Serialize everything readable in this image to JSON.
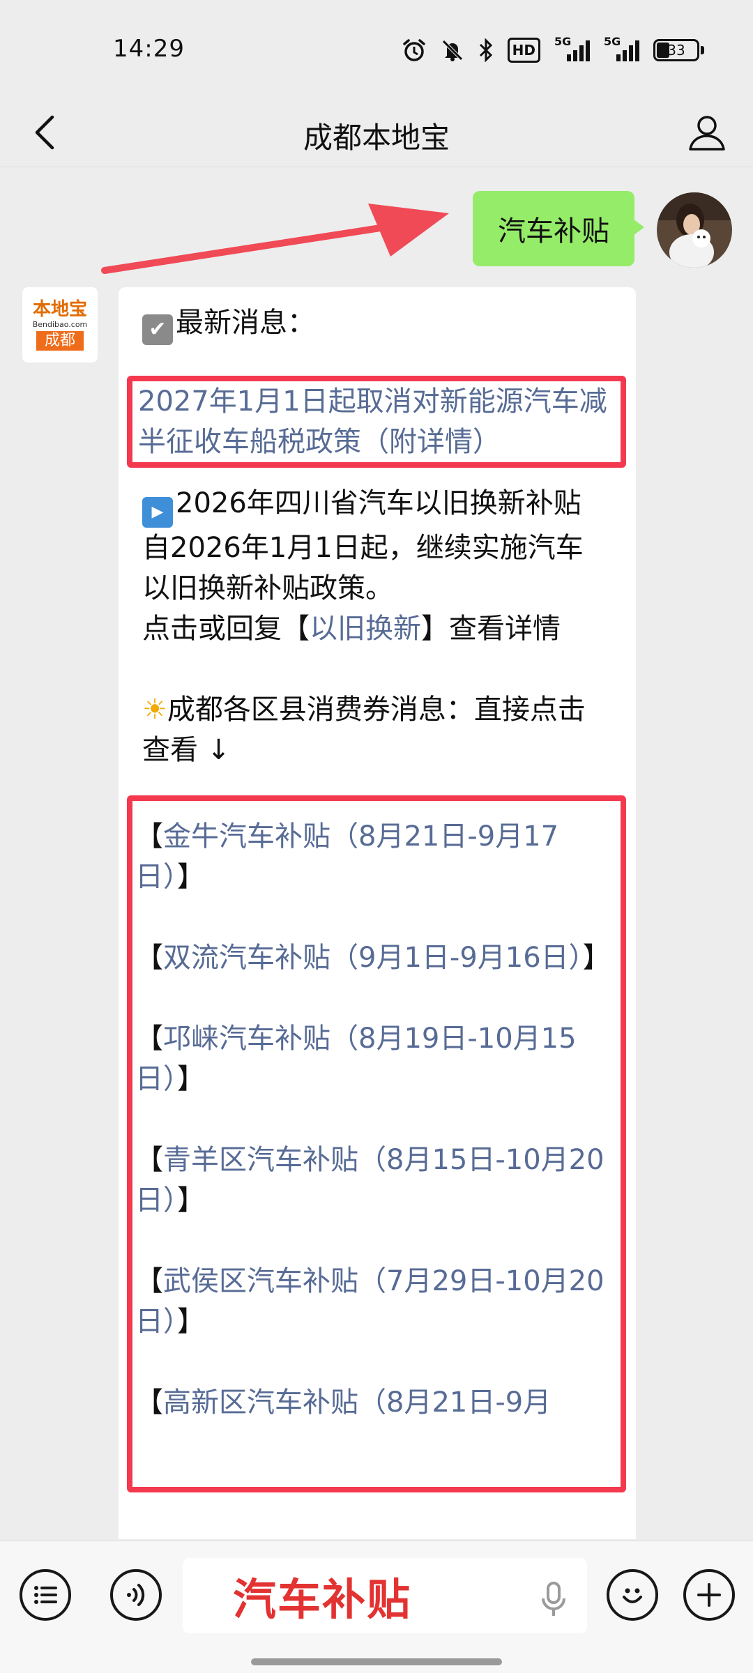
{
  "status_bar": {
    "time": "14:29",
    "hd_label": "HD",
    "sim1_label": "5G",
    "sim2_label": "5G",
    "battery_percent": "33",
    "battery_level": 0.33,
    "icons": [
      "alarm-icon",
      "mute-icon",
      "bluetooth-icon",
      "hd-voice-icon",
      "signal-icon",
      "signal-icon",
      "battery-icon"
    ]
  },
  "header": {
    "title": "成都本地宝",
    "back_icon": "chevron-left-icon",
    "profile_icon": "person-icon"
  },
  "chat": {
    "user_message": "汽车补贴",
    "official_account": {
      "logo_brand": "本地宝",
      "logo_domain": "Bendibao.com",
      "logo_city": "成都"
    },
    "reply": {
      "latest_heading": "最新消息：",
      "tax_policy_link": "2027年1月1日起取消对新能源汽车减半征收车船税政策（附详情）",
      "sichuan_title": "2026年四川省汽车以旧换新补贴",
      "sichuan_body": "自2026年1月1日起，继续实施汽车以旧换新补贴政策。",
      "reply_prefix": "点击或回复【",
      "reply_link": "以旧换新",
      "reply_suffix": "】查看详情",
      "vouchers_heading": "成都各区县消费券消息：直接点击查看 ↓",
      "district_items": [
        {
          "text": "金牛汽车补贴（8月21日-9月17日）"
        },
        {
          "text": "双流汽车补贴（9月1日-9月16日）"
        },
        {
          "text": "邛崃汽车补贴（8月19日-10月15日）"
        },
        {
          "text": "青羊区汽车补贴（8月15日-10月20日）"
        },
        {
          "text": "武侯区汽车补贴（7月29日-10月20日）"
        },
        {
          "text": "高新区汽车补贴（8月21日-9月"
        }
      ],
      "bracket_open": "【",
      "bracket_close": "】"
    }
  },
  "input_bar": {
    "input_value": "汽车补贴",
    "icons": [
      "menu-icon",
      "voice-icon",
      "mic-icon",
      "emoji-icon",
      "plus-icon"
    ]
  },
  "colors": {
    "user_bubble": "#95ec69",
    "link": "#576b95",
    "highlight_box": "#f4394f",
    "input_text": "#e33232"
  }
}
